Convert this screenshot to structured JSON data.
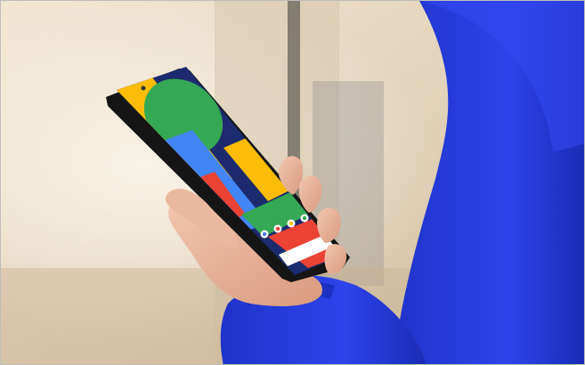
{
  "scene": {
    "description_tag": "photo-hand-holding-smartphone",
    "colors": {
      "background_warm": "#e9dcc6",
      "background_light": "#f4efe6",
      "sleeve_blue": "#2a3fe0",
      "sleeve_dark": "#1224a8",
      "skin": "#e9b79c",
      "phone_frame": "#1a1a1a",
      "wall_green": "#34a853",
      "wall_yellow": "#fbbc05",
      "wall_blue": "#4285f4",
      "wall_red": "#ea4335",
      "wall_navy": "#1c2a6e",
      "search_bar": "#ffffff"
    }
  },
  "phone": {
    "status_time": "",
    "dock_icons": [
      "google-app-icon",
      "chrome-icon",
      "photos-icon",
      "messages-icon",
      "camera-icon"
    ]
  }
}
